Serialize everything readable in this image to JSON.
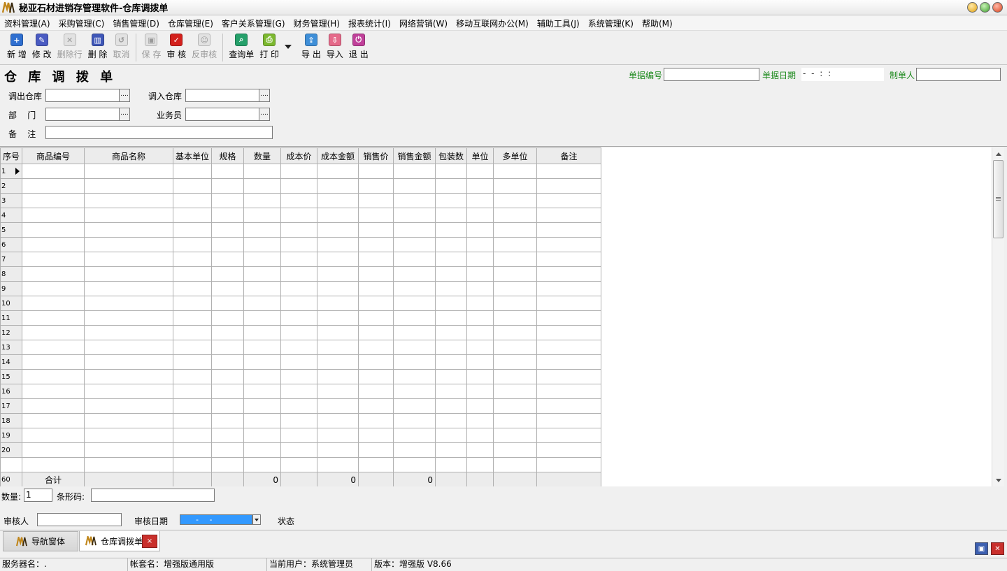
{
  "window": {
    "title": "秘亚石材进销存管理软件-仓库调拨单"
  },
  "menu": [
    "资料管理(A)",
    "采购管理(C)",
    "销售管理(D)",
    "仓库管理(E)",
    "客户关系管理(G)",
    "财务管理(H)",
    "报表统计(I)",
    "网络营销(W)",
    "移动互联网办公(M)",
    "辅助工具(J)",
    "系统管理(K)",
    "帮助(M)"
  ],
  "toolbar": {
    "add": "新 增",
    "edit": "修 改",
    "delete_row": "删除行",
    "delete": "删 除",
    "cancel": "取消",
    "save": "保 存",
    "audit": "审 核",
    "unaudit": "反审核",
    "query": "查询单",
    "print": "打  印",
    "export": "导 出",
    "import": "导入",
    "exit": "退 出"
  },
  "form": {
    "title": "仓 库 调 拨 单",
    "doc_no_label": "单据编号",
    "doc_date_label": "单据日期",
    "doc_date_value": "  -  -    :  :  ",
    "maker_label": "制单人",
    "out_warehouse_label": "调出仓库",
    "in_warehouse_label": "调入仓库",
    "department_label": "部    门",
    "salesperson_label": "业务员",
    "remark_label": "备    注",
    "ellipsis": "...."
  },
  "grid": {
    "columns": [
      "序号",
      "商品编号",
      "商品名称",
      "基本单位",
      "规格",
      "数量",
      "成本价",
      "成本金额",
      "销售价",
      "销售金额",
      "包装数",
      "单位",
      "多单位",
      "备注"
    ],
    "rows": [
      "1",
      "2",
      "3",
      "4",
      "5",
      "6",
      "7",
      "8",
      "9",
      "10",
      "11",
      "12",
      "13",
      "14",
      "15",
      "16",
      "17",
      "18",
      "19",
      "20"
    ],
    "total": {
      "row_no": "60",
      "label": "合计",
      "quantity": "0",
      "cost_amount": "0",
      "sales_amount": "0"
    }
  },
  "bottom": {
    "quantity_label": "数量:",
    "quantity_value": "1",
    "barcode_label": "条形码:",
    "auditor_label": "审核人",
    "audit_date_label": "审核日期",
    "audit_date_value": "- -",
    "status_label": "状态"
  },
  "tabs": {
    "nav": "导航窗体",
    "active": "仓库调拨单",
    "close": "×"
  },
  "statusbar": {
    "server": "服务器名：.",
    "account": "帐套名：增强版通用版",
    "user": "当前用户：系统管理员",
    "version": "版本：增强版 V8.66"
  },
  "colors": {
    "green_label": "#1e8a1e",
    "selection": "#3399ff",
    "close_red": "#c9302c"
  }
}
